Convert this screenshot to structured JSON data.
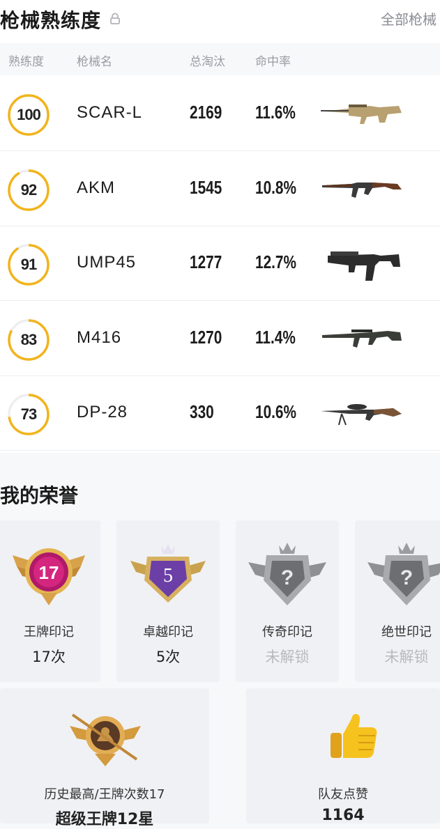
{
  "header": {
    "title": "枪械熟练度",
    "all_link": "全部枪械"
  },
  "columns": {
    "proficiency": "熟练度",
    "name": "枪械名",
    "kills": "总淘汰",
    "accuracy": "命中率"
  },
  "weapons": [
    {
      "proficiency": "100",
      "name": "SCAR-L",
      "kills": "2169",
      "accuracy": "11.6%",
      "icon": "scar-l-rifle-icon"
    },
    {
      "proficiency": "92",
      "name": "AKM",
      "kills": "1545",
      "accuracy": "10.8%",
      "icon": "akm-rifle-icon"
    },
    {
      "proficiency": "91",
      "name": "UMP45",
      "kills": "1277",
      "accuracy": "12.7%",
      "icon": "ump45-smg-icon"
    },
    {
      "proficiency": "83",
      "name": "M416",
      "kills": "1270",
      "accuracy": "11.4%",
      "icon": "m416-rifle-icon"
    },
    {
      "proficiency": "73",
      "name": "DP-28",
      "kills": "330",
      "accuracy": "10.6%",
      "icon": "dp28-lmg-icon"
    }
  ],
  "honors": {
    "title": "我的荣誉",
    "cards": [
      {
        "label": "王牌印记",
        "value": "17次",
        "locked": false,
        "badge_text": "17"
      },
      {
        "label": "卓越印记",
        "value": "5次",
        "locked": false,
        "badge_text": "5"
      },
      {
        "label": "传奇印记",
        "value": "未解锁",
        "locked": true,
        "badge_text": "?"
      },
      {
        "label": "绝世印记",
        "value": "未解锁",
        "locked": true,
        "badge_text": "?"
      }
    ],
    "summary": [
      {
        "label": "历史最高/王牌次数17",
        "value": "超级王牌12星",
        "icon": "super-ace-badge-icon"
      },
      {
        "label": "队友点赞",
        "value": "1164",
        "icon": "thumbs-up-icon"
      }
    ]
  },
  "colors": {
    "ring": "#f2b41c",
    "ring_track": "#eeeef0",
    "accent": "#f2b41c"
  }
}
